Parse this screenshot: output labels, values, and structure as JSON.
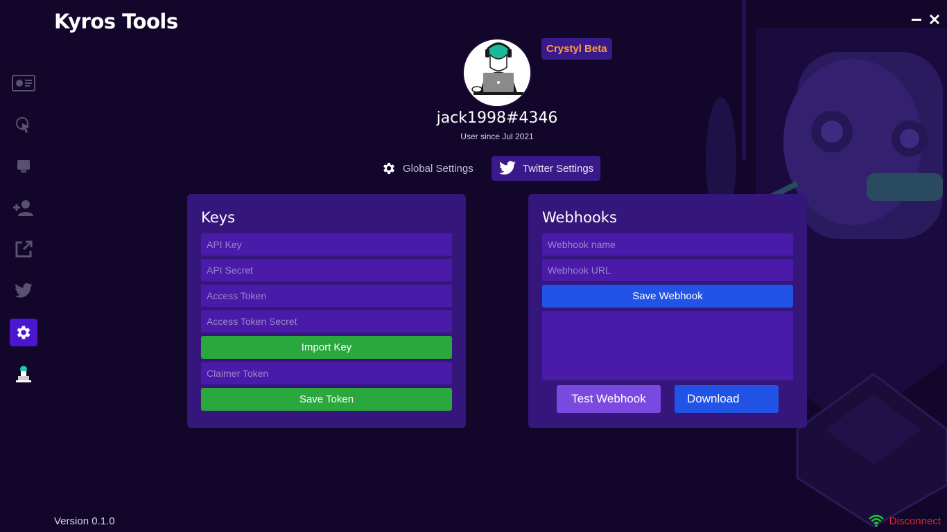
{
  "app": {
    "title": "Kyros Tools",
    "version": "Version 0.1.0"
  },
  "window": {
    "minimize_icon": "minimize-icon",
    "close_icon": "close-icon"
  },
  "sidebar": {
    "items": [
      {
        "name": "dashboard",
        "icon": "dashboard-icon"
      },
      {
        "name": "cursor",
        "icon": "cursor-click-icon"
      },
      {
        "name": "monitor",
        "icon": "monitor-icon"
      },
      {
        "name": "add-user",
        "icon": "add-user-icon"
      },
      {
        "name": "external-link",
        "icon": "external-link-icon"
      },
      {
        "name": "twitter",
        "icon": "twitter-icon"
      },
      {
        "name": "settings",
        "icon": "gear-icon",
        "active": true
      },
      {
        "name": "profile",
        "icon": "user-avatar-icon"
      }
    ]
  },
  "profile": {
    "badge": "Crystyl Beta",
    "username": "jack1998#4346",
    "since": "User since Jul 2021"
  },
  "tabs": [
    {
      "label": "Global Settings",
      "icon": "gear-icon",
      "active": false
    },
    {
      "label": "Twitter Settings",
      "icon": "twitter-icon",
      "active": true
    }
  ],
  "keys_panel": {
    "title": "Keys",
    "api_key_placeholder": "API Key",
    "api_secret_placeholder": "API Secret",
    "access_token_placeholder": "Access Token",
    "access_token_secret_placeholder": "Access Token Secret",
    "import_key_label": "Import Key",
    "claimer_token_placeholder": "Claimer Token",
    "save_token_label": "Save Token"
  },
  "webhooks_panel": {
    "title": "Webhooks",
    "name_placeholder": "Webhook name",
    "url_placeholder": "Webhook URL",
    "save_label": "Save Webhook",
    "test_label": "Test Webhook",
    "download_label": "Download"
  },
  "status": {
    "label": "Disconnect",
    "icon": "wifi-icon"
  },
  "colors": {
    "background": "#12072a",
    "panel": "#35167a",
    "field": "#4a1aa8",
    "green": "#2aa83d",
    "blue": "#2053e6",
    "purple": "#7a4ae0",
    "badge_text": "#ff9d3b",
    "disconnect": "#e02a2a"
  }
}
